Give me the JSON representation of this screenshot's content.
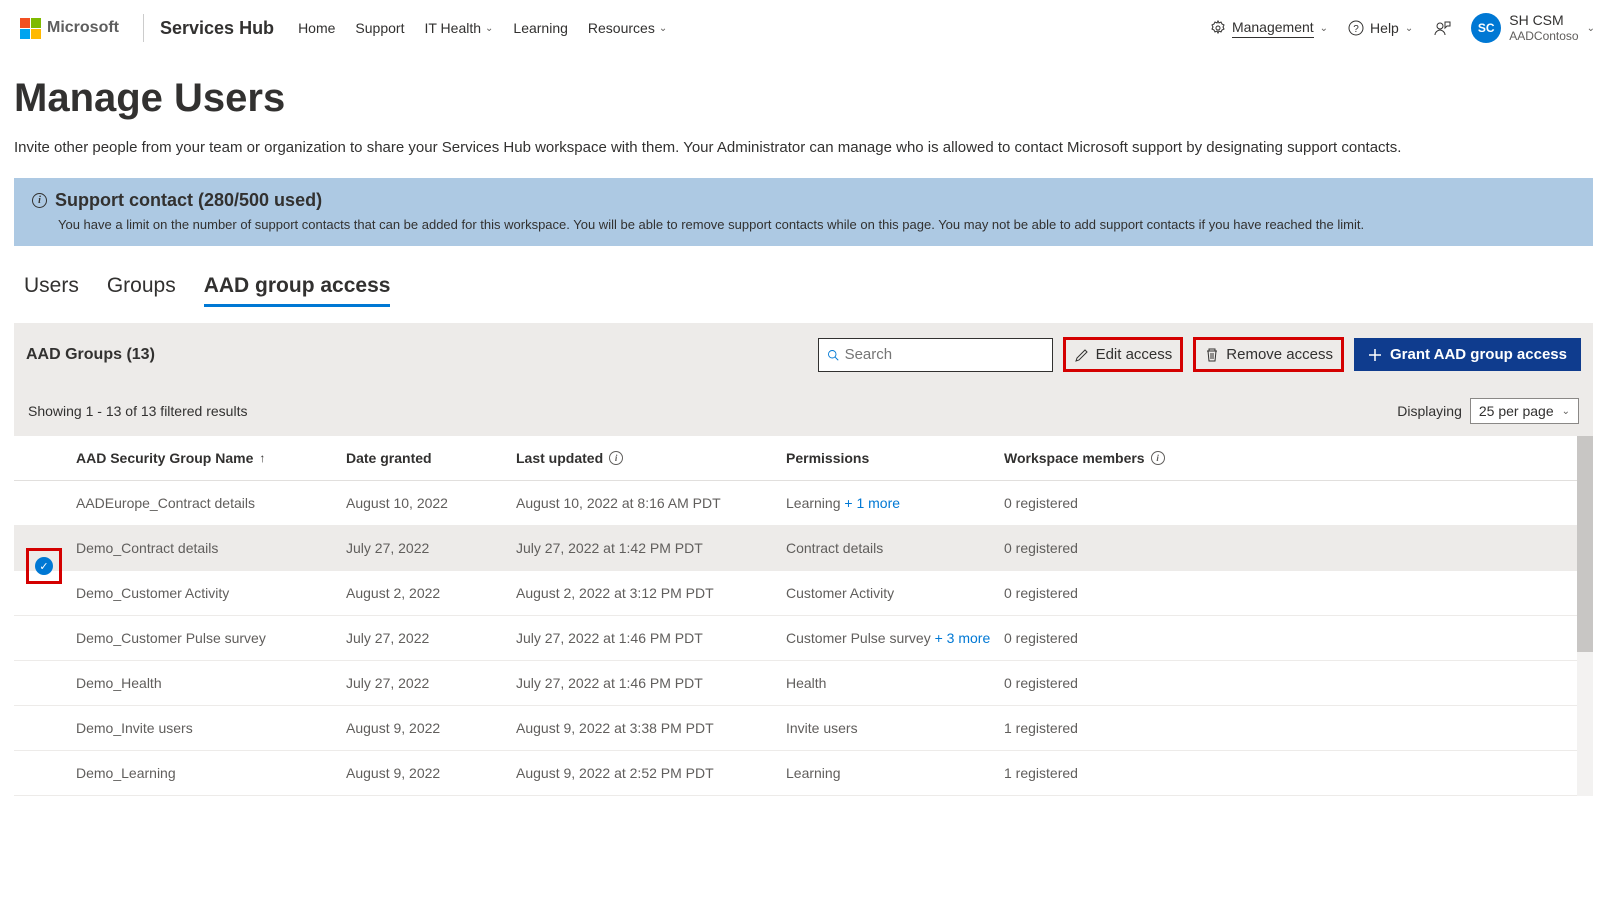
{
  "header": {
    "ms": "Microsoft",
    "brand": "Services Hub",
    "nav": [
      "Home",
      "Support",
      "IT Health",
      "Learning",
      "Resources"
    ],
    "management": "Management",
    "help": "Help",
    "avatar_initials": "SC",
    "account_name": "SH CSM",
    "account_org": "AADContoso"
  },
  "page": {
    "title": "Manage Users",
    "subtitle": "Invite other people from your team or organization to share your Services Hub workspace with them. Your Administrator can manage who is allowed to contact Microsoft support by designating support contacts."
  },
  "infobox": {
    "title": "Support contact (280/500 used)",
    "body": "You have a limit on the number of support contacts that can be added for this workspace. You will be able to remove support contacts while on this page. You may not be able to add support contacts if you have reached the limit."
  },
  "tabs": {
    "users": "Users",
    "groups": "Groups",
    "aad": "AAD group access"
  },
  "toolbar": {
    "title": "AAD Groups (13)",
    "search_placeholder": "Search",
    "edit": "Edit access",
    "remove": "Remove access",
    "grant": "Grant AAD group access"
  },
  "results": {
    "showing": "Showing 1 - 13 of 13 filtered results",
    "displaying": "Displaying",
    "per_page": "25 per page"
  },
  "columns": {
    "name": "AAD Security Group Name",
    "date": "Date granted",
    "updated": "Last updated",
    "perm": "Permissions",
    "members": "Workspace members"
  },
  "rows": [
    {
      "name": "AADEurope_Contract details",
      "date": "August 10, 2022",
      "updated": "August 10, 2022 at 8:16 AM PDT",
      "perm": "Learning",
      "more": "+ 1 more",
      "members": "0 registered",
      "selected": false
    },
    {
      "name": "Demo_Contract details",
      "date": "July 27, 2022",
      "updated": "July 27, 2022 at 1:42 PM PDT",
      "perm": "Contract details",
      "more": "",
      "members": "0 registered",
      "selected": true
    },
    {
      "name": "Demo_Customer Activity",
      "date": "August 2, 2022",
      "updated": "August 2, 2022 at 3:12 PM PDT",
      "perm": "Customer Activity",
      "more": "",
      "members": "0 registered",
      "selected": false
    },
    {
      "name": "Demo_Customer Pulse survey",
      "date": "July 27, 2022",
      "updated": "July 27, 2022 at 1:46 PM PDT",
      "perm": "Customer Pulse survey",
      "more": "+ 3 more",
      "members": "0 registered",
      "selected": false
    },
    {
      "name": "Demo_Health",
      "date": "July 27, 2022",
      "updated": "July 27, 2022 at 1:46 PM PDT",
      "perm": "Health",
      "more": "",
      "members": "0 registered",
      "selected": false
    },
    {
      "name": "Demo_Invite users",
      "date": "August 9, 2022",
      "updated": "August 9, 2022 at 3:38 PM PDT",
      "perm": "Invite users",
      "more": "",
      "members": "1 registered",
      "selected": false
    },
    {
      "name": "Demo_Learning",
      "date": "August 9, 2022",
      "updated": "August 9, 2022 at 2:52 PM PDT",
      "perm": "Learning",
      "more": "",
      "members": "1 registered",
      "selected": false
    }
  ]
}
